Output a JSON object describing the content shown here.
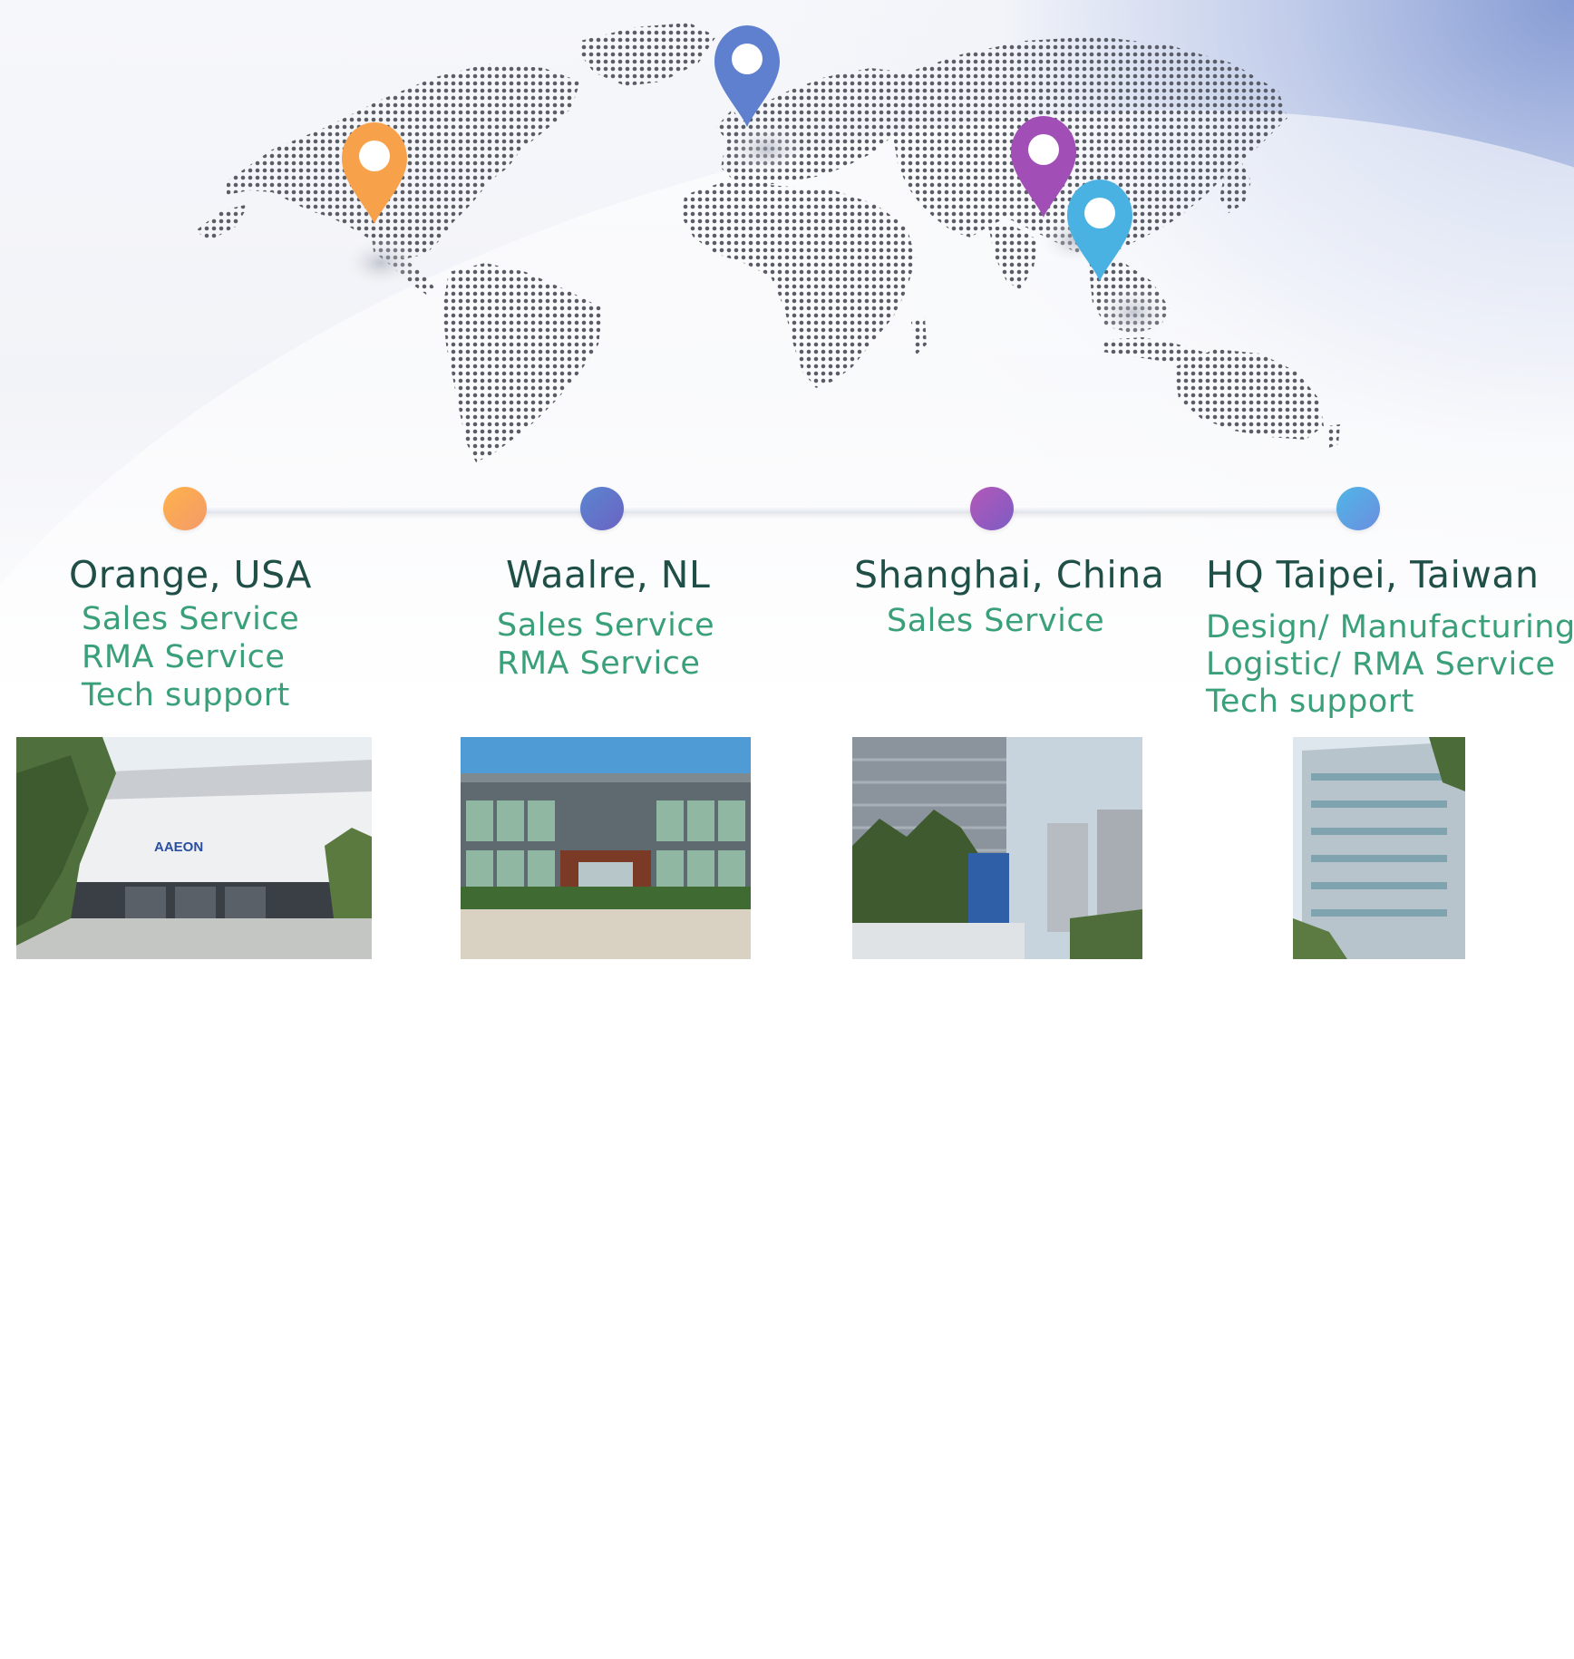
{
  "locations": [
    {
      "title": "Orange, USA",
      "services": [
        "Sales Service",
        "RMA Service",
        "Tech support"
      ],
      "color_start": "#ffb24a",
      "color_end": "#f39a6a",
      "pin_color": "#f7a24b",
      "photo_caption": "AAEON"
    },
    {
      "title": "Waalre, NL",
      "services": [
        "Sales Service",
        "RMA Service"
      ],
      "color_start": "#5a86d0",
      "color_end": "#6b63c2",
      "pin_color": "#5f7fcf"
    },
    {
      "title": "Shanghai, China",
      "services": [
        "Sales Service"
      ],
      "color_start": "#b458b8",
      "color_end": "#7d5cc4",
      "pin_color": "#a14fb6"
    },
    {
      "title": "HQ Taipei, Taiwan",
      "services": [
        "Design/ Manufacturing",
        "Logistic/ RMA Service",
        "Tech support"
      ],
      "color_start": "#4fb6e6",
      "color_end": "#6c8ee0",
      "pin_color": "#4ab2e3"
    }
  ],
  "colors": {
    "title_text": "#1f4f47",
    "service_text": "#3aa07a",
    "map_dots": "#5a5d66",
    "background_accent": "#7f93d0"
  }
}
